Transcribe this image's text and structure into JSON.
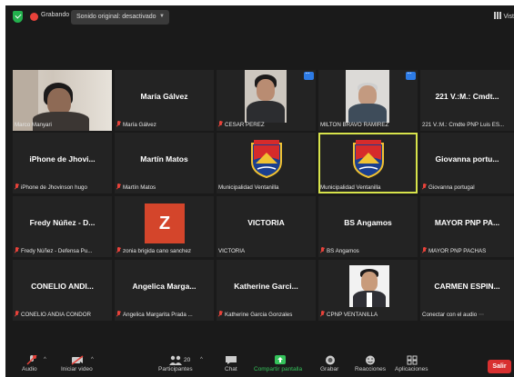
{
  "topbar": {
    "recording_label": "Grabando",
    "audio_pill": "Sonido original: desactivado",
    "view_label": "Vist"
  },
  "tiles": [
    {
      "name": "",
      "label": "Marco Manyari",
      "muted": false
    },
    {
      "name": "María Gálvez",
      "label": "María Gálvez",
      "muted": true
    },
    {
      "name": "",
      "label": "CESAR PEREZ",
      "muted": true
    },
    {
      "name": "",
      "label": "MILTON BRAVO RAMIREZ",
      "muted": false
    },
    {
      "name": "221 V.:M.: Cmdt...",
      "label": "221 V.:M.: Cmdte PNP Luis ES...",
      "muted": false
    },
    {
      "name": "iPhone de Jhovi...",
      "label": "iPhone de Jhovinson hugo",
      "muted": true
    },
    {
      "name": "Martín Matos",
      "label": "Martín Matos",
      "muted": true
    },
    {
      "name": "",
      "label": "Municipalidad Ventanilla",
      "muted": false
    },
    {
      "name": "",
      "label": "Municipalidad Ventanilla",
      "muted": false
    },
    {
      "name": "Giovanna portu...",
      "label": "Giovanna portugal",
      "muted": true
    },
    {
      "name": "Fredy Núñez - D...",
      "label": "Fredy Núñez - Defensa Pu...",
      "muted": true
    },
    {
      "name": "Z",
      "label": "zonia brigida cano sanchez",
      "muted": true
    },
    {
      "name": "VICTORIA",
      "label": "VICTORIA",
      "muted": false
    },
    {
      "name": "BS Angamos",
      "label": "BS Angamos",
      "muted": true
    },
    {
      "name": "MAYOR PNP PA...",
      "label": "MAYOR PNP PACHAS",
      "muted": true
    },
    {
      "name": "CONELIO ANDI...",
      "label": "CONELIO ANDIA CONDOR",
      "muted": true
    },
    {
      "name": "Angelica Marga...",
      "label": "Angelica Margarita Prada ...",
      "muted": true
    },
    {
      "name": "Katherine Garci...",
      "label": "Katherine Garcia Gonzales",
      "muted": true
    },
    {
      "name": "",
      "label": "CPNP VENTANILLA",
      "muted": true
    },
    {
      "name": "CARMEN ESPIN...",
      "label": "Conectar con el audio",
      "muted": false
    }
  ],
  "toolbar": {
    "audio": "Audio",
    "video": "Iniciar video",
    "participants": "Participantes",
    "participants_count": "20",
    "chat": "Chat",
    "share": "Compartir pantalla",
    "record": "Grabar",
    "reactions": "Reacciones",
    "apps": "Aplicaciones",
    "leave": "Salir"
  },
  "colors": {
    "accent_green": "#35c35b",
    "leave_red": "#d83030",
    "rec_red": "#e8423a",
    "selected": "#d7e34b",
    "avatar_z": "#d4452b"
  }
}
